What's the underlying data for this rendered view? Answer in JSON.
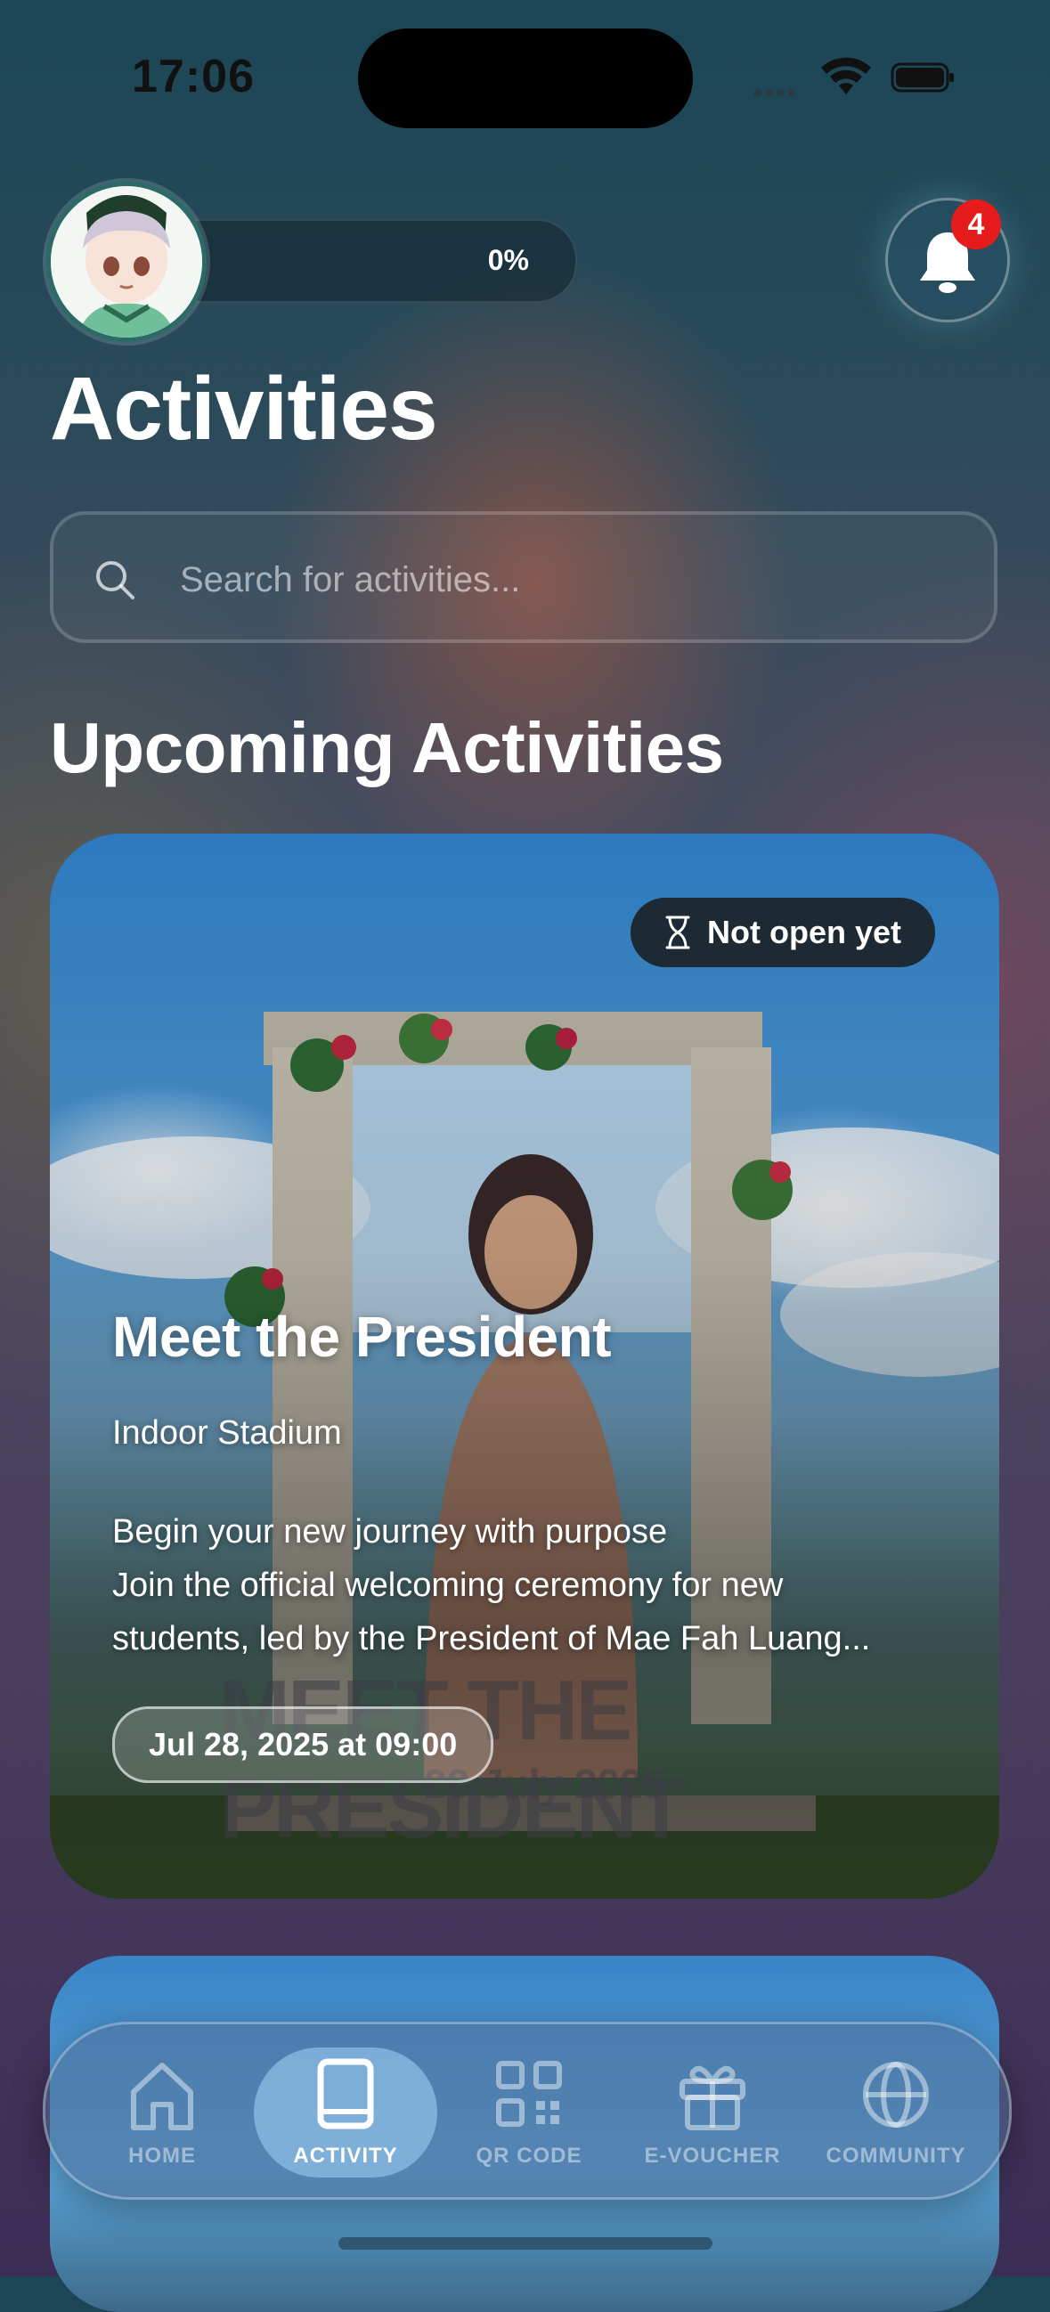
{
  "status_bar": {
    "time": "17:06"
  },
  "header": {
    "progress_text": "0%",
    "notification_count": "4"
  },
  "page_title": "Activities",
  "search": {
    "placeholder": "Search for activities..."
  },
  "section_title": "Upcoming Activities",
  "activities": [
    {
      "status": "Not open yet",
      "title": "Meet the President",
      "location": "Indoor Stadium",
      "description_line1": "Begin your new journey with purpose",
      "description_line2": "Join the official welcoming ceremony for new",
      "description_line3": "students, led by the President of Mae Fah Luang...",
      "datetime": "Jul 28, 2025 at 09:00",
      "poster_title": "MEET THE PRESIDENT",
      "poster_date": "28 July 2025"
    }
  ],
  "tabs": [
    {
      "label": "HOME",
      "icon": "home-icon"
    },
    {
      "label": "ACTIVITY",
      "icon": "book-icon",
      "active": true
    },
    {
      "label": "QR CODE",
      "icon": "qr-code-icon"
    },
    {
      "label": "E-VOUCHER",
      "icon": "gift-icon"
    },
    {
      "label": "COMMUNITY",
      "icon": "globe-icon"
    }
  ],
  "colors": {
    "badge": "#e61b1b",
    "active_tab": "#8cbee6",
    "status_pill": "#1d2a33"
  }
}
